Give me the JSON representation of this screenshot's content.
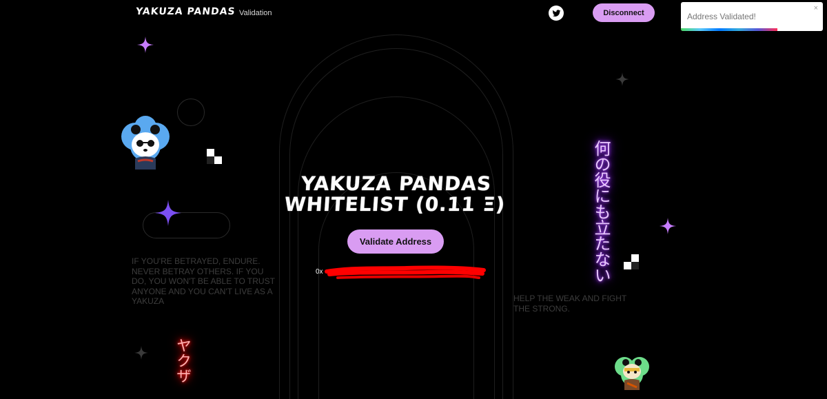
{
  "nav": {
    "brand": "YAKUZA PANDAS",
    "link_validation": "Validation",
    "disconnect_label": "Disconnect",
    "twitter_icon": "twitter-icon"
  },
  "toast": {
    "message": "Address Validated!",
    "close_symbol": "×",
    "progress_remaining": 0.68
  },
  "main": {
    "title": "YAKUZA PANDAS WHITELIST (0.11 Ξ)",
    "validate_label": "Validate Address",
    "address_prefix": "0x"
  },
  "quotes": {
    "left": "IF YOU'RE BETRAYED, ENDURE. NEVER BETRAY OTHERS. IF YOU DO, YOU WON'T BE ABLE TO TRUST ANYONE AND YOU CAN'T LIVE AS A YAKUZA",
    "right": "HELP THE WEAK AND FIGHT THE STRONG."
  },
  "neon": {
    "purple": "何の役にも立たない",
    "red": "ヤクザ"
  },
  "colors": {
    "background": "#000000",
    "accent_button": "#d99cf2",
    "neon_purple": "#8b2cf5",
    "neon_red": "#ff0000",
    "quote_text": "#3d3d3d"
  }
}
